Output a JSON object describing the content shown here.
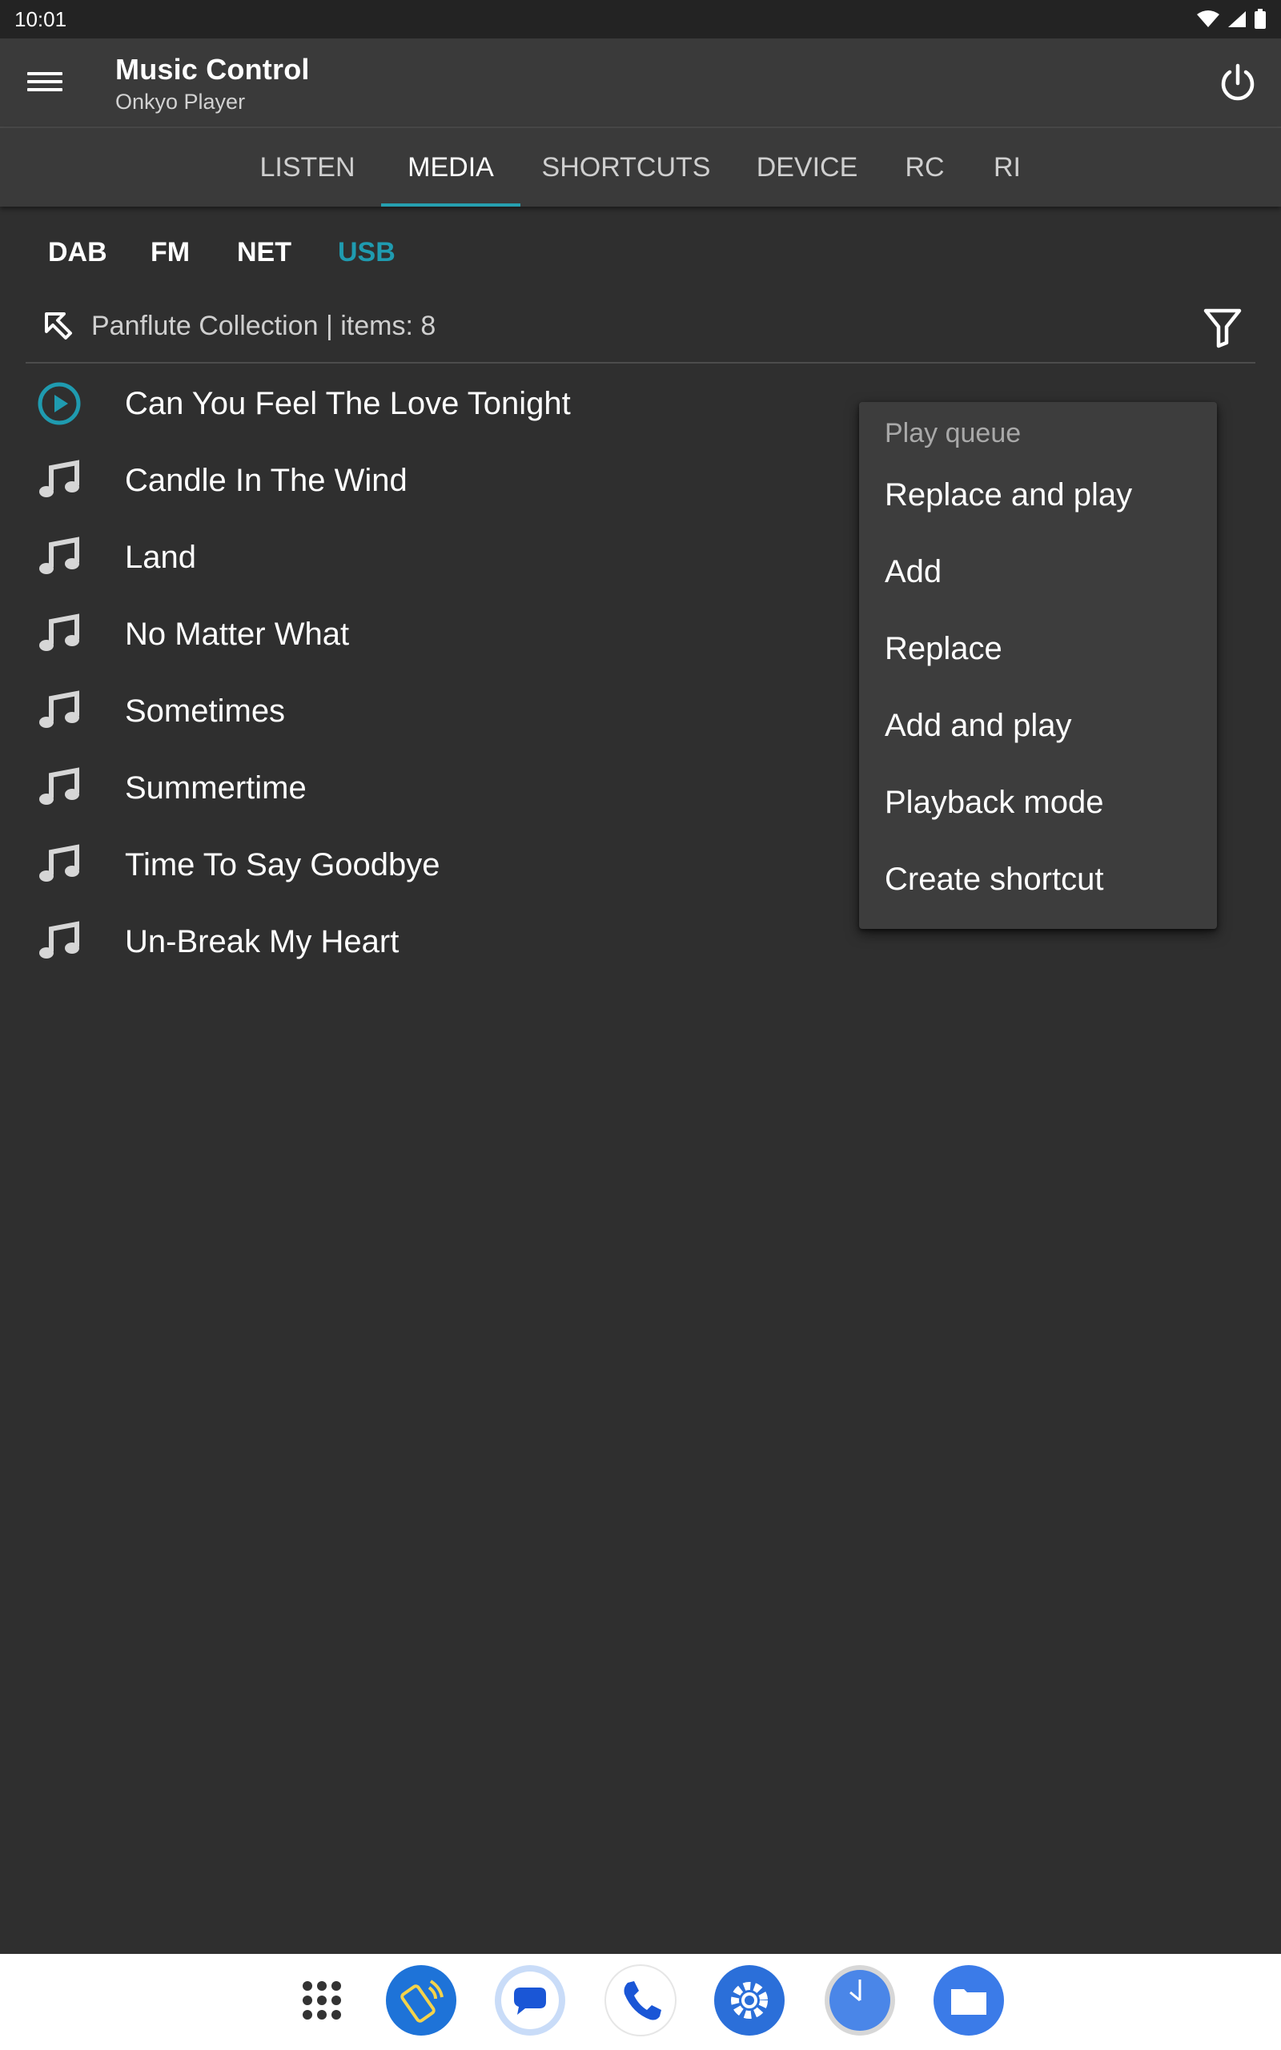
{
  "status_bar": {
    "time": "10:01"
  },
  "app_bar": {
    "title": "Music Control",
    "subtitle": "Onkyo Player"
  },
  "tabs": [
    {
      "label": "LISTEN",
      "active": false
    },
    {
      "label": "MEDIA",
      "active": true
    },
    {
      "label": "SHORTCUTS",
      "active": false
    },
    {
      "label": "DEVICE",
      "active": false
    },
    {
      "label": "RC",
      "active": false
    },
    {
      "label": "RI",
      "active": false
    }
  ],
  "sources": [
    {
      "label": "DAB",
      "active": false
    },
    {
      "label": "FM",
      "active": false
    },
    {
      "label": "NET",
      "active": false
    },
    {
      "label": "USB",
      "active": true
    }
  ],
  "path": {
    "label": "Panflute Collection | items: 8"
  },
  "tracks": [
    {
      "title": "Can You Feel The Love Tonight",
      "icon": "play-circle-icon"
    },
    {
      "title": "Candle In The Wind",
      "icon": "music-note-icon"
    },
    {
      "title": "Land",
      "icon": "music-note-icon"
    },
    {
      "title": "No Matter What",
      "icon": "music-note-icon"
    },
    {
      "title": "Sometimes",
      "icon": "music-note-icon"
    },
    {
      "title": "Summertime",
      "icon": "music-note-icon"
    },
    {
      "title": "Time To Say Goodbye",
      "icon": "music-note-icon"
    },
    {
      "title": "Un-Break My Heart",
      "icon": "music-note-icon"
    }
  ],
  "popup": {
    "header": "Play queue",
    "items": [
      "Replace and play",
      "Add",
      "Replace",
      "Add and play",
      "Playback mode",
      "Create shortcut"
    ]
  },
  "colors": {
    "accent": "#1f9bb0",
    "background": "#2f2f2f",
    "appbar": "#3a3a3a"
  },
  "dock": [
    {
      "icon": "app-drawer-icon"
    },
    {
      "icon": "remote-app-icon"
    },
    {
      "icon": "messages-app-icon"
    },
    {
      "icon": "phone-app-icon"
    },
    {
      "icon": "settings-app-icon"
    },
    {
      "icon": "clock-app-icon"
    },
    {
      "icon": "files-app-icon"
    }
  ]
}
